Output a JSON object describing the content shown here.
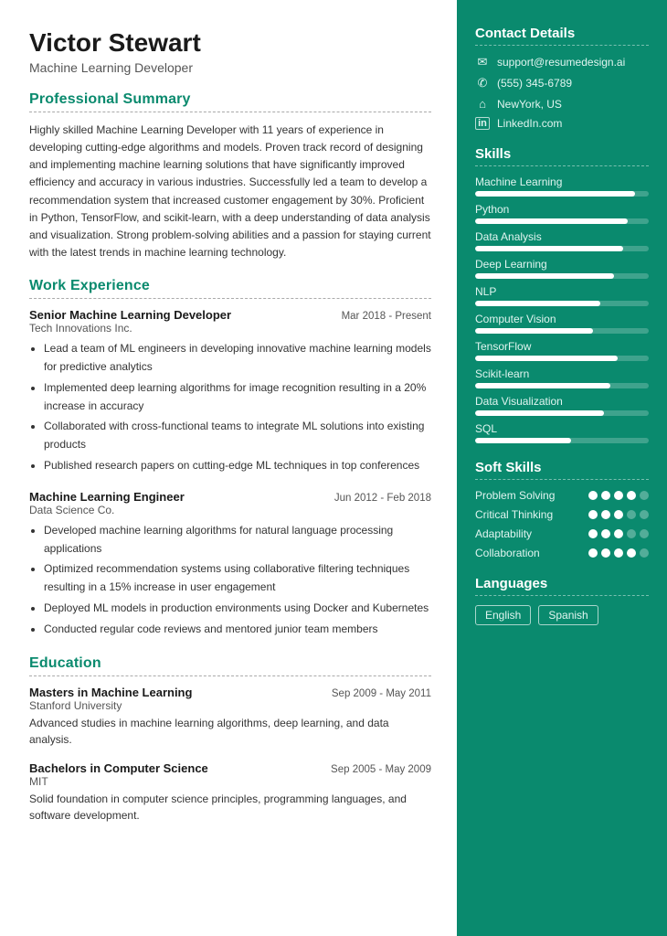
{
  "left": {
    "name": "Victor Stewart",
    "title": "Machine Learning Developer",
    "sections": {
      "summary": {
        "label": "Professional Summary",
        "text": "Highly skilled Machine Learning Developer with 11 years of experience in developing cutting-edge algorithms and models. Proven track record of designing and implementing machine learning solutions that have significantly improved efficiency and accuracy in various industries. Successfully led a team to develop a recommendation system that increased customer engagement by 30%. Proficient in Python, TensorFlow, and scikit-learn, with a deep understanding of data analysis and visualization. Strong problem-solving abilities and a passion for staying current with the latest trends in machine learning technology."
      },
      "experience": {
        "label": "Work Experience",
        "jobs": [
          {
            "title": "Senior Machine Learning Developer",
            "date": "Mar 2018 - Present",
            "company": "Tech Innovations Inc.",
            "bullets": [
              "Lead a team of ML engineers in developing innovative machine learning models for predictive analytics",
              "Implemented deep learning algorithms for image recognition resulting in a 20% increase in accuracy",
              "Collaborated with cross-functional teams to integrate ML solutions into existing products",
              "Published research papers on cutting-edge ML techniques in top conferences"
            ]
          },
          {
            "title": "Machine Learning Engineer",
            "date": "Jun 2012 - Feb 2018",
            "company": "Data Science Co.",
            "bullets": [
              "Developed machine learning algorithms for natural language processing applications",
              "Optimized recommendation systems using collaborative filtering techniques resulting in a 15% increase in user engagement",
              "Deployed ML models in production environments using Docker and Kubernetes",
              "Conducted regular code reviews and mentored junior team members"
            ]
          }
        ]
      },
      "education": {
        "label": "Education",
        "items": [
          {
            "degree": "Masters in Machine Learning",
            "date": "Sep 2009 - May 2011",
            "school": "Stanford University",
            "desc": "Advanced studies in machine learning algorithms, deep learning, and data analysis."
          },
          {
            "degree": "Bachelors in Computer Science",
            "date": "Sep 2005 - May 2009",
            "school": "MIT",
            "desc": "Solid foundation in computer science principles, programming languages, and software development."
          }
        ]
      }
    }
  },
  "right": {
    "contact": {
      "label": "Contact Details",
      "items": [
        {
          "icon": "✉",
          "text": "support@resumedesign.ai"
        },
        {
          "icon": "✆",
          "text": "(555) 345-6789"
        },
        {
          "icon": "⌂",
          "text": "NewYork, US"
        },
        {
          "icon": "in",
          "text": "LinkedIn.com"
        }
      ]
    },
    "skills": {
      "label": "Skills",
      "items": [
        {
          "name": "Machine Learning",
          "pct": 92
        },
        {
          "name": "Python",
          "pct": 88
        },
        {
          "name": "Data Analysis",
          "pct": 85
        },
        {
          "name": "Deep Learning",
          "pct": 80
        },
        {
          "name": "NLP",
          "pct": 72
        },
        {
          "name": "Computer Vision",
          "pct": 68
        },
        {
          "name": "TensorFlow",
          "pct": 82
        },
        {
          "name": "Scikit-learn",
          "pct": 78
        },
        {
          "name": "Data Visualization",
          "pct": 74
        },
        {
          "name": "SQL",
          "pct": 55
        }
      ]
    },
    "softSkills": {
      "label": "Soft Skills",
      "items": [
        {
          "name": "Problem Solving",
          "filled": 4,
          "total": 5
        },
        {
          "name": "Critical Thinking",
          "filled": 3,
          "total": 5
        },
        {
          "name": "Adaptability",
          "filled": 3,
          "total": 5
        },
        {
          "name": "Collaboration",
          "filled": 4,
          "total": 5
        }
      ]
    },
    "languages": {
      "label": "Languages",
      "items": [
        "English",
        "Spanish"
      ]
    }
  }
}
